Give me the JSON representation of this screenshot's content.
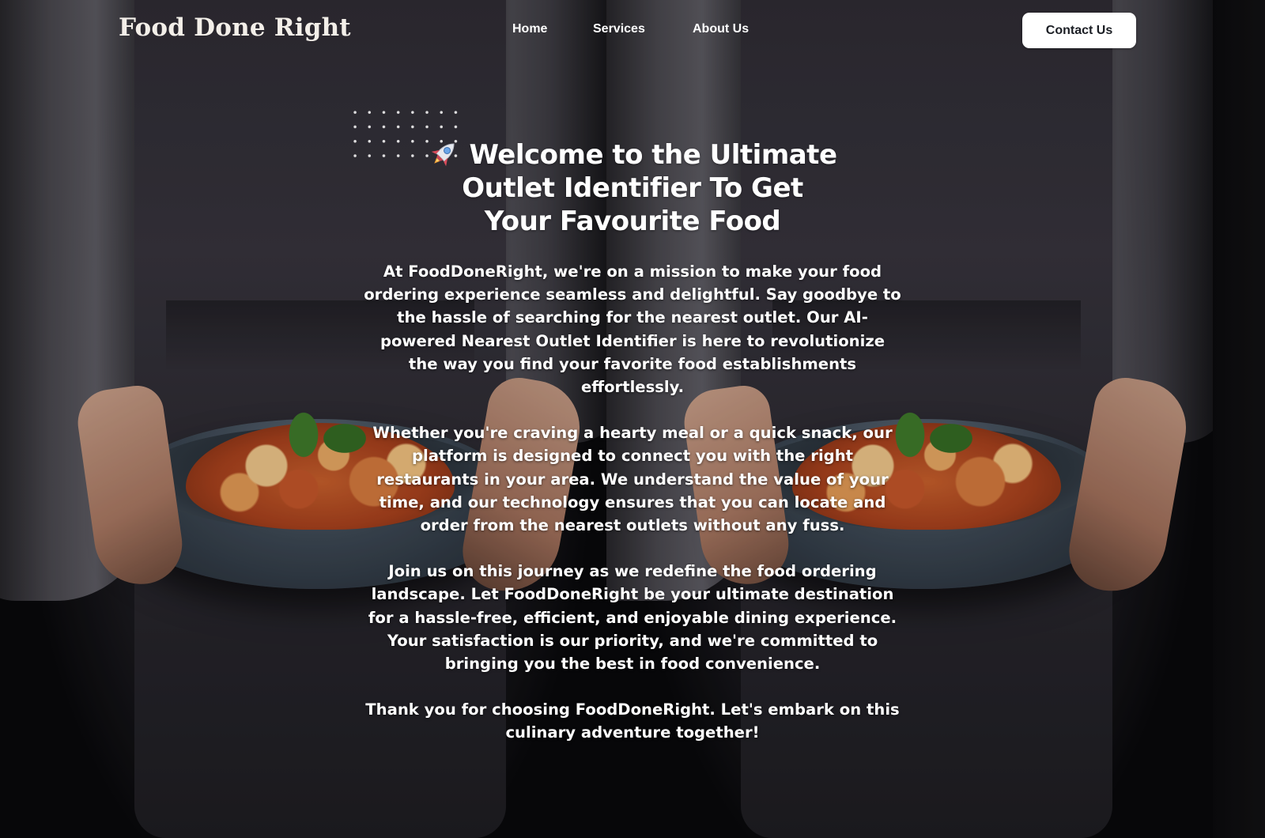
{
  "header": {
    "logo": "Food Done Right",
    "nav": {
      "home": "Home",
      "services": "Services",
      "about": "About Us"
    },
    "contact_button": "Contact Us"
  },
  "hero": {
    "icon": "rocket-icon",
    "title": "Welcome to the Ultimate Outlet Identifier To Get Your Favourite Food",
    "paragraphs": [
      "At FoodDoneRight, we're on a mission to make your food ordering experience seamless and delightful. Say goodbye to the hassle of searching for the nearest outlet. Our AI-powered Nearest Outlet Identifier is here to revolutionize the way you find your favorite food establishments effortlessly.",
      "Whether you're craving a hearty meal or a quick snack, our platform is designed to connect you with the right restaurants in your area. We understand the value of your time, and our technology ensures that you can locate and order from the nearest outlets without any fuss.",
      "Join us on this journey as we redefine the food ordering landscape. Let FoodDoneRight be your ultimate destination for a hassle-free, efficient, and enjoyable dining experience. Your satisfaction is our priority, and we're committed to bringing you the best in food convenience.",
      "Thank you for choosing FoodDoneRight. Let's embark on this culinary adventure together!"
    ]
  },
  "colors": {
    "text": "#ffffff",
    "button_bg": "#ffffff",
    "button_text": "#1b1e24",
    "background": "#0d0c10"
  }
}
